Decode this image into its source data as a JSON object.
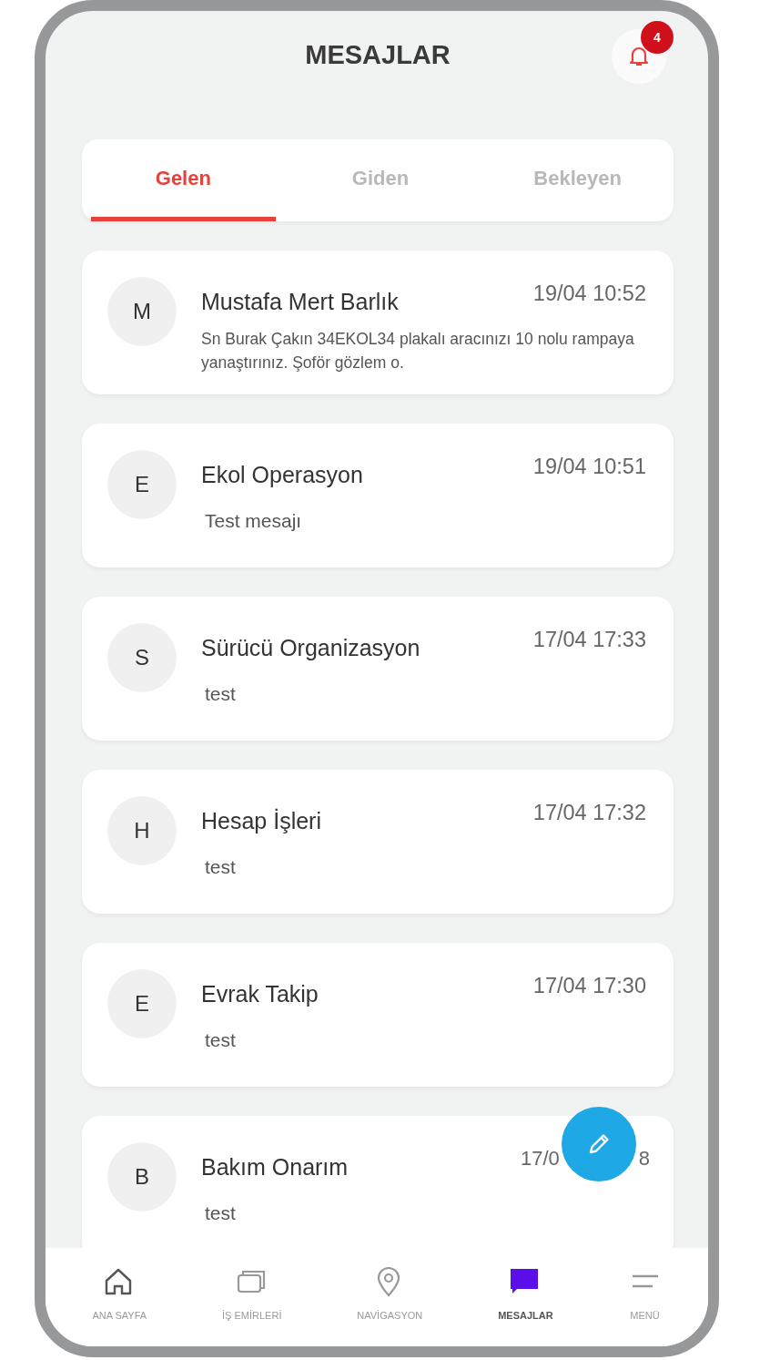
{
  "header": {
    "title": "MESAJLAR",
    "notification_count": "4"
  },
  "tabs": [
    {
      "label": "Gelen",
      "selected": true
    },
    {
      "label": "Giden",
      "selected": false
    },
    {
      "label": "Bekleyen",
      "selected": false
    }
  ],
  "messages": [
    {
      "initial": "M",
      "sender": "Mustafa Mert Barlık",
      "time_parts": [
        "19/04 10:52"
      ],
      "preview": "Sn Burak Çakın 34EKOL34 plakalı aracınızı 10 nolu rampaya yanaştırınız. Şoför gözlem o.",
      "kind": "long"
    },
    {
      "initial": "E",
      "sender": "Ekol Operasyon",
      "time_parts": [
        "19/04 10:51"
      ],
      "preview": "Test mesajı",
      "kind": "short"
    },
    {
      "initial": "S",
      "sender": "Sürücü Organizasyon",
      "time_parts": [
        "17/04 17:33"
      ],
      "preview": "test",
      "kind": "short"
    },
    {
      "initial": "H",
      "sender": "Hesap İşleri",
      "time_parts": [
        "17/04 17:32"
      ],
      "preview": "test",
      "kind": "short"
    },
    {
      "initial": "E",
      "sender": "Evrak Takip",
      "time_parts": [
        "17/04 17:30"
      ],
      "preview": "test",
      "kind": "short"
    },
    {
      "initial": "B",
      "sender": "Bakım Onarım",
      "time_parts": [
        "17/0",
        "8"
      ],
      "preview": "test",
      "kind": "short"
    }
  ],
  "bottom_nav": [
    {
      "label": "ANA SAYFA",
      "selected": false
    },
    {
      "label": "İŞ EMİRLERİ",
      "selected": false
    },
    {
      "label": "NAVİGASYON",
      "selected": false
    },
    {
      "label": "MESAJLAR",
      "selected": true
    },
    {
      "label": "MENÜ",
      "selected": false
    }
  ]
}
